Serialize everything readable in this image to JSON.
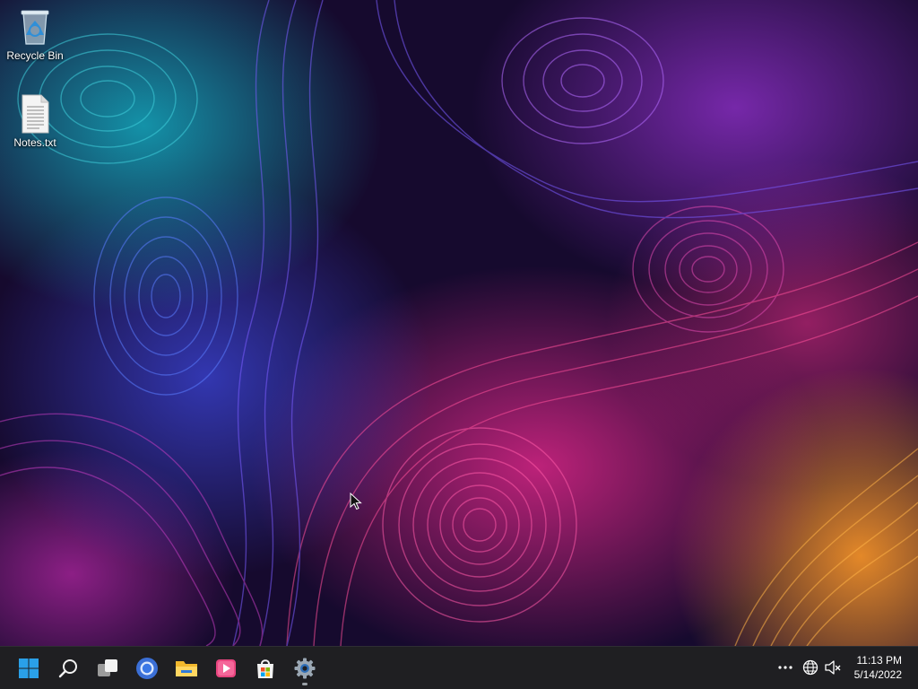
{
  "desktop": {
    "icons": [
      {
        "label": "Recycle Bin",
        "icon": "recycle-bin-icon"
      },
      {
        "label": "Notes.txt",
        "icon": "text-file-icon"
      }
    ]
  },
  "taskbar": {
    "apps": [
      {
        "name": "start",
        "icon": "windows-logo-icon"
      },
      {
        "name": "search",
        "icon": "search-icon"
      },
      {
        "name": "task-view",
        "icon": "task-view-icon"
      },
      {
        "name": "chrome",
        "icon": "chrome-icon"
      },
      {
        "name": "file-explorer",
        "icon": "folder-icon"
      },
      {
        "name": "media-player",
        "icon": "media-player-icon"
      },
      {
        "name": "microsoft-store",
        "icon": "store-icon"
      },
      {
        "name": "settings",
        "icon": "gear-icon",
        "active": true
      }
    ],
    "tray": {
      "icons": [
        "overflow-dots-icon",
        "network-globe-icon",
        "speaker-muted-icon"
      ],
      "time": "11:13 PM",
      "date": "5/14/2022"
    }
  },
  "colors": {
    "taskbar_bg": "#1f1f22",
    "windows_blue": "#2aa0e8"
  }
}
